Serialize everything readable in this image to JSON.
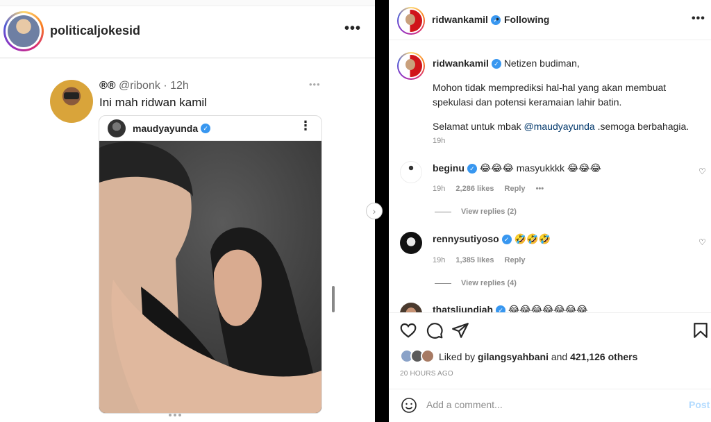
{
  "left_post": {
    "username": "politicaljokesid",
    "more_icon": "more-horizontal-icon",
    "tweet": {
      "flags": "®®",
      "handle": "@ribonk",
      "separator": "·",
      "time": "12h",
      "text": "Ini mah ridwan kamil",
      "embed": {
        "username": "maudyayunda",
        "verified": true
      }
    }
  },
  "right_post": {
    "header": {
      "username": "ridwankamil",
      "separator": "•",
      "follow_label": "Following"
    },
    "caption": {
      "username": "ridwankamil",
      "line1": "Netizen budiman,",
      "line2": "Mohon tidak memprediksi hal-hal yang akan membuat spekulasi dan potensi keramaian lahir batin.",
      "line3_prefix": "Selamat untuk mbak ",
      "mention": "@maudyayunda",
      "line3_suffix": " .semoga berbahagia.",
      "time": "19h"
    },
    "comments": [
      {
        "username": "beginu",
        "text": "😂😂😂 masyukkkk 😂😂😂",
        "time": "19h",
        "likes": "2,286 likes",
        "reply_label": "Reply",
        "more": "•••",
        "view_replies": "View replies (2)"
      },
      {
        "username": "rennysutiyoso",
        "text": "🤣🤣🤣",
        "time": "19h",
        "likes": "1,385 likes",
        "reply_label": "Reply",
        "view_replies": "View replies (4)"
      },
      {
        "username": "thatsliundiah",
        "text": "😂😂😂😂😂😂😂"
      }
    ],
    "liked_by_prefix": "Liked by ",
    "liked_by_user": "gilangsyahbani",
    "liked_by_middle": " and ",
    "liked_by_count": "421,126 others",
    "posted_ago": "20 HOURS AGO",
    "comment_placeholder": "Add a comment...",
    "post_label": "Post"
  },
  "colors": {
    "verified": "#3897f0",
    "post_disabled": "#b3dbff",
    "mention": "#00376b",
    "muted": "#8e8e8e"
  }
}
